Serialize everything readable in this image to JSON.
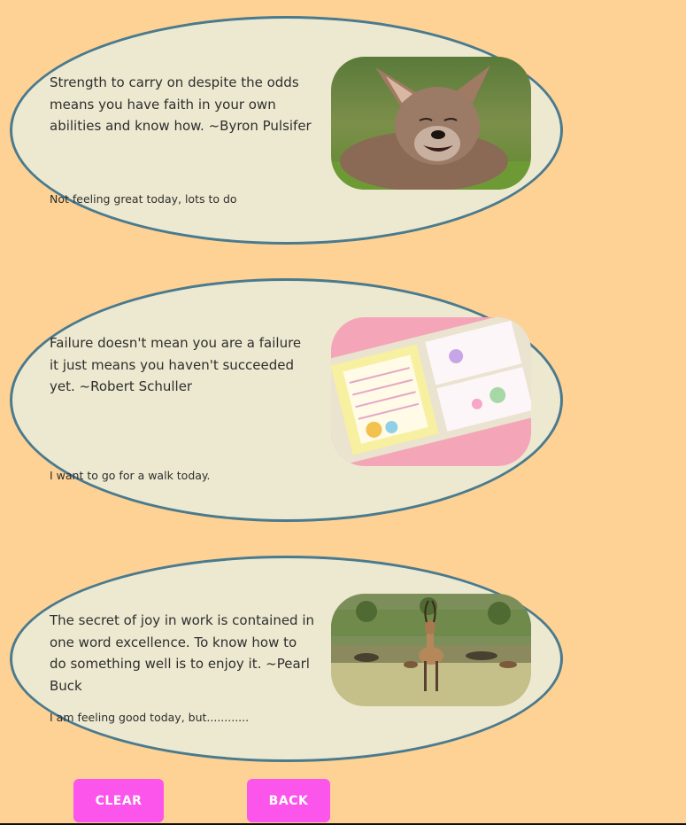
{
  "cards": [
    {
      "quote": "Strength to carry on despite the odds means you have faith in your own abilities and know how. ~Byron Pulsifer",
      "note": "Not feeling great today, lots to do",
      "image": "laughing-coyote-photo"
    },
    {
      "quote": "Failure doesn't mean you are a failure it just means you haven't succeeded yet. ~Robert Schuller",
      "note": "I want to go for a walk today.",
      "image": "stationery-notepads-photo"
    },
    {
      "quote": "The secret of joy in work is contained in one word excellence. To know how to do something well is to enjoy it. ~Pearl Buck",
      "note": "I am feeling good today, but............",
      "image": "antelope-savanna-photo"
    }
  ],
  "buttons": {
    "clear": "CLEAR",
    "back": "BACK"
  },
  "colors": {
    "background": "#fed295",
    "card": "#ede9d0",
    "card_border": "#4a7a8e",
    "button": "#fb55ec"
  }
}
